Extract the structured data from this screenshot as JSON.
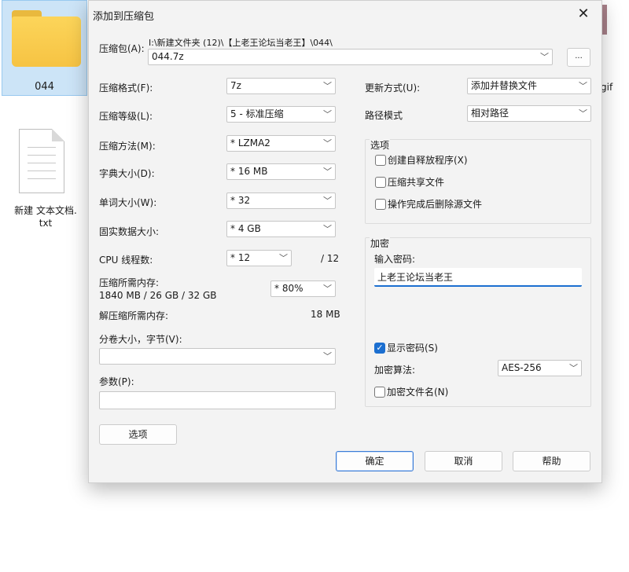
{
  "desktop": {
    "folder_label": "044",
    "txt_label_line1": "新建 文本文档.",
    "txt_label_line2": "txt",
    "gif_label": "gif"
  },
  "dialog": {
    "title": "添加到压缩包",
    "archive_label": "压缩包(A):",
    "archive_path": "I:\\新建文件夹 (12)\\【上老王论坛当老王】\\044\\",
    "archive_name": "044.7z",
    "browse_label": "...",
    "format_label": "压缩格式(F):",
    "format_value": "7z",
    "level_label": "压缩等级(L):",
    "level_value": "5 - 标准压缩",
    "method_label": "压缩方法(M):",
    "method_value": "* LZMA2",
    "dict_label": "字典大小(D):",
    "dict_value": "* 16 MB",
    "word_label": "单词大小(W):",
    "word_value": "* 32",
    "solid_label": "固实数据大小:",
    "solid_value": "* 4 GB",
    "threads_label": "CPU 线程数:",
    "threads_value": "* 12",
    "threads_total": "/ 12",
    "mem_label": "压缩所需内存:",
    "mem_detail": "1840 MB / 26 GB / 32 GB",
    "mem_percent": "* 80%",
    "decomp_label": "解压缩所需内存:",
    "decomp_value": "18 MB",
    "volume_label": "分卷大小，字节(V):",
    "volume_value": "",
    "params_label": "参数(P):",
    "params_value": "",
    "options_button": "选项",
    "update_label": "更新方式(U):",
    "update_value": "添加并替换文件",
    "pathmode_label": "路径模式",
    "pathmode_value": "相对路径",
    "options_group": "选项",
    "opt_sfx": "创建自释放程序(X)",
    "opt_shared": "压缩共享文件",
    "opt_delete": "操作完成后删除源文件",
    "encrypt_group": "加密",
    "password_label": "输入密码:",
    "password_value": "上老王论坛当老王",
    "show_password": "显示密码(S)",
    "show_password_checked": true,
    "algo_label": "加密算法:",
    "algo_value": "AES-256",
    "encrypt_names": "加密文件名(N)",
    "ok": "确定",
    "cancel": "取消",
    "help": "帮助"
  },
  "colors": {
    "accent": "#1c6fd0",
    "dialog_bg": "#f3f3f3",
    "folder": "#f6c343"
  }
}
